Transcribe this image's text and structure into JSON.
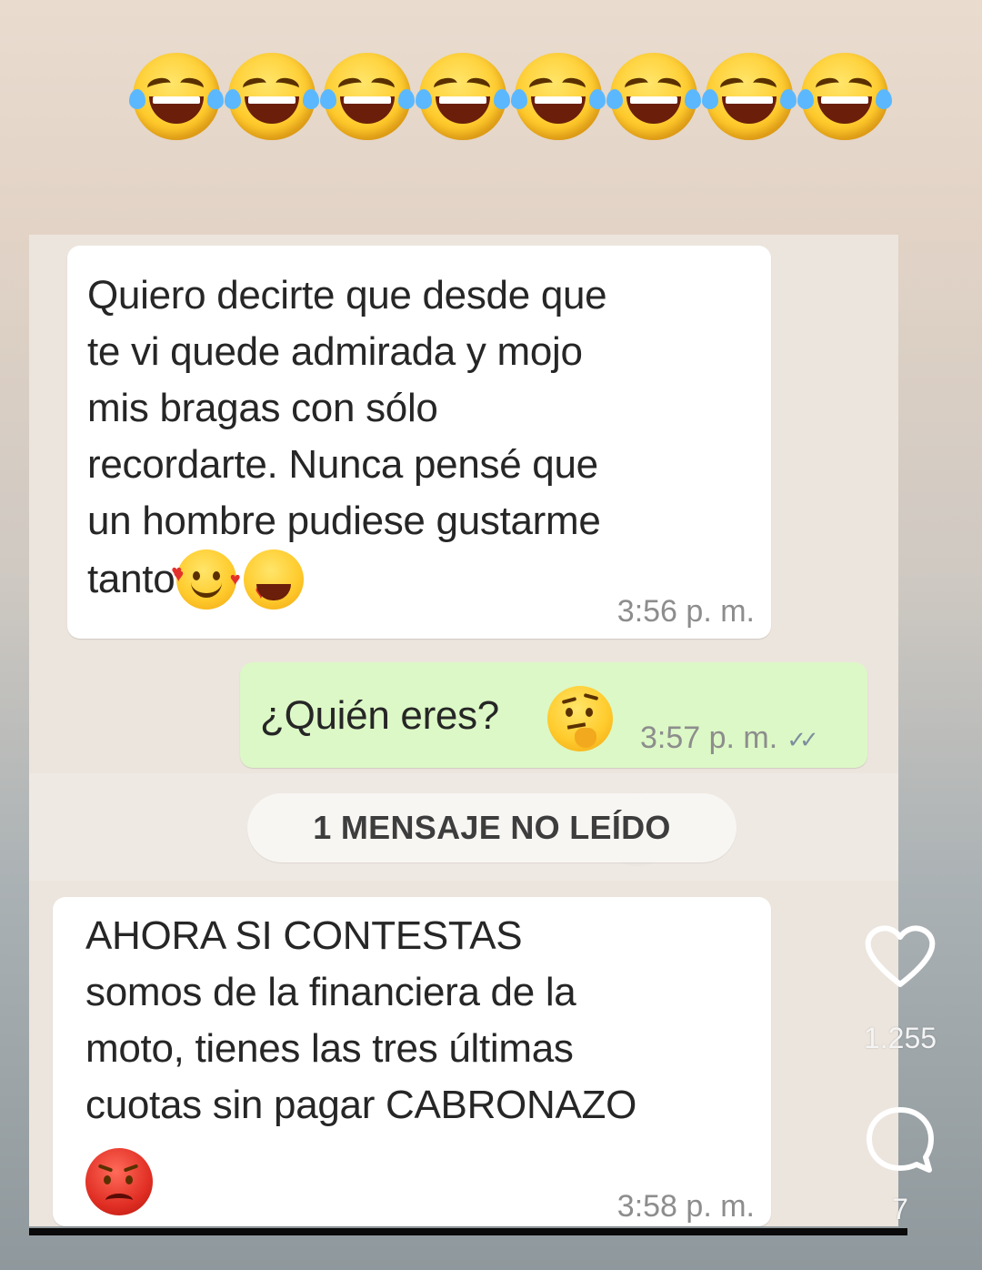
{
  "header": {
    "emojis": [
      "rolling-laughing",
      "rolling-laughing",
      "rolling-laughing",
      "rolling-laughing",
      "rolling-laughing",
      "rolling-laughing",
      "rolling-laughing",
      "rolling-laughing"
    ]
  },
  "messages": [
    {
      "direction": "incoming",
      "lines": [
        "Quiero decirte que desde que",
        "te vi quede admirada y mojo",
        "mis bragas con sólo",
        "recordarte. Nunca pensé que",
        "un hombre pudiese gustarme",
        "tanto"
      ],
      "emojis": [
        "smiling-face-with-hearts",
        "heart-eyes"
      ],
      "time": "3:56 p. m."
    },
    {
      "direction": "outgoing",
      "text": "¿Quién eres?",
      "emojis": [
        "thinking-face"
      ],
      "time": "3:57 p. m.",
      "status": "read"
    },
    {
      "direction": "incoming",
      "lines": [
        "AHORA SI CONTESTAS",
        "somos de la financiera de la",
        "moto, tienes las tres últimas",
        "cuotas sin pagar CABRONAZO"
      ],
      "emojis": [
        "angry-face"
      ],
      "time": "3:58 p. m."
    }
  ],
  "unread_banner": "1 MENSAJE NO LEÍDO",
  "sidebar": {
    "like_icon": "heart-outline-icon",
    "like_count": "1.255",
    "comment_icon": "comment-bubble-icon",
    "comment_count": "7"
  },
  "colors": {
    "incoming_bubble": "#ffffff",
    "outgoing_bubble": "#dcf8c6",
    "chat_background": "#ece5dd"
  }
}
